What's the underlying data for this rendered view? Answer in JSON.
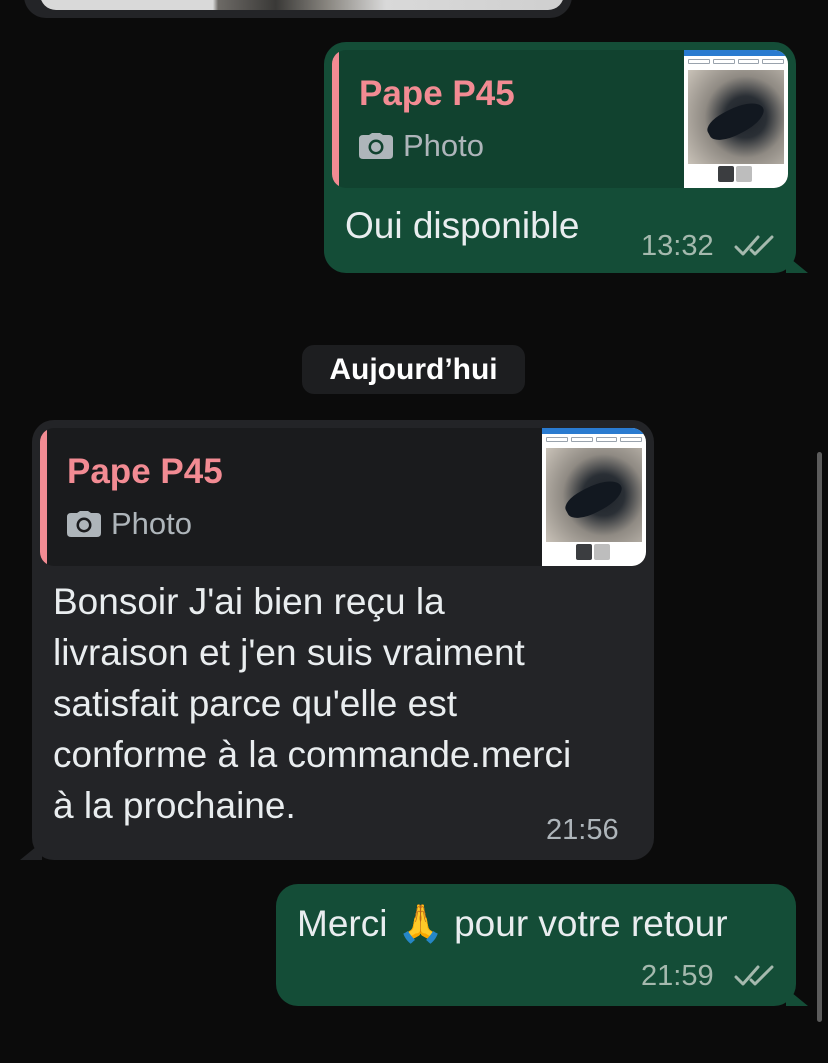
{
  "chat": {
    "date_separator": "Aujourd’hui",
    "messages": [
      {
        "direction": "outgoing",
        "quote_author": "Pape P45",
        "quote_type": "Photo",
        "text": "Oui disponible",
        "time": "13:32",
        "status": "read"
      },
      {
        "direction": "incoming",
        "quote_author": "Pape P45",
        "quote_type": "Photo",
        "text": "Bonsoir J'ai bien reçu la\nlivraison et j'en suis vraiment\nsatisfait parce qu'elle est\nconforme à la commande.merci\nà la prochaine.",
        "time": "21:56"
      },
      {
        "direction": "outgoing",
        "text_before_emoji": "Merci",
        "emoji": "🙏",
        "text_after_emoji": "pour votre retour",
        "time": "21:59",
        "status": "read"
      }
    ]
  },
  "colors": {
    "background": "#0b0b0b",
    "outgoing_bubble": "#144d37",
    "incoming_bubble": "#232427",
    "quote_accent": "#f28b93",
    "read_ticks": "#a5b9ae"
  },
  "icons": {
    "quote_media": "camera-icon",
    "status": "double-check-icon"
  }
}
